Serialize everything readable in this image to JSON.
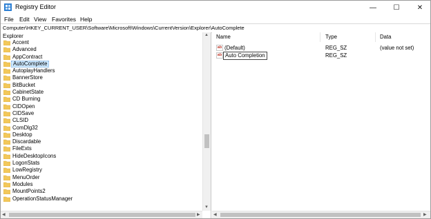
{
  "window": {
    "title": "Registry Editor",
    "controls": {
      "minimize": "—",
      "maximize": "☐",
      "close": "✕"
    }
  },
  "menu": [
    "File",
    "Edit",
    "View",
    "Favorites",
    "Help"
  ],
  "address": "Computer\\HKEY_CURRENT_USER\\Software\\Microsoft\\Windows\\CurrentVersion\\Explorer\\AutoComplete",
  "tree": {
    "root": "Explorer",
    "items": [
      "Accent",
      "Advanced",
      "AppContract",
      "AutoComplete",
      "AutoplayHandlers",
      "BannerStore",
      "BitBucket",
      "CabinetState",
      "CD Burning",
      "CIDOpen",
      "CIDSave",
      "CLSID",
      "ComDlg32",
      "Desktop",
      "Discardable",
      "FileExts",
      "HideDesktopIcons",
      "LogonStats",
      "LowRegistry",
      "MenuOrder",
      "Modules",
      "MountPoints2",
      "OperationStatusManager"
    ],
    "selected": "AutoComplete"
  },
  "values": {
    "columns": [
      "Name",
      "Type",
      "Data"
    ],
    "rows": [
      {
        "name": "(Default)",
        "type": "REG_SZ",
        "data": "(value not set)"
      },
      {
        "name": "Auto Completion",
        "type": "REG_SZ",
        "data": ""
      }
    ]
  },
  "colors": {
    "selection": "#cce8ff",
    "folder": "#f3c85a"
  }
}
